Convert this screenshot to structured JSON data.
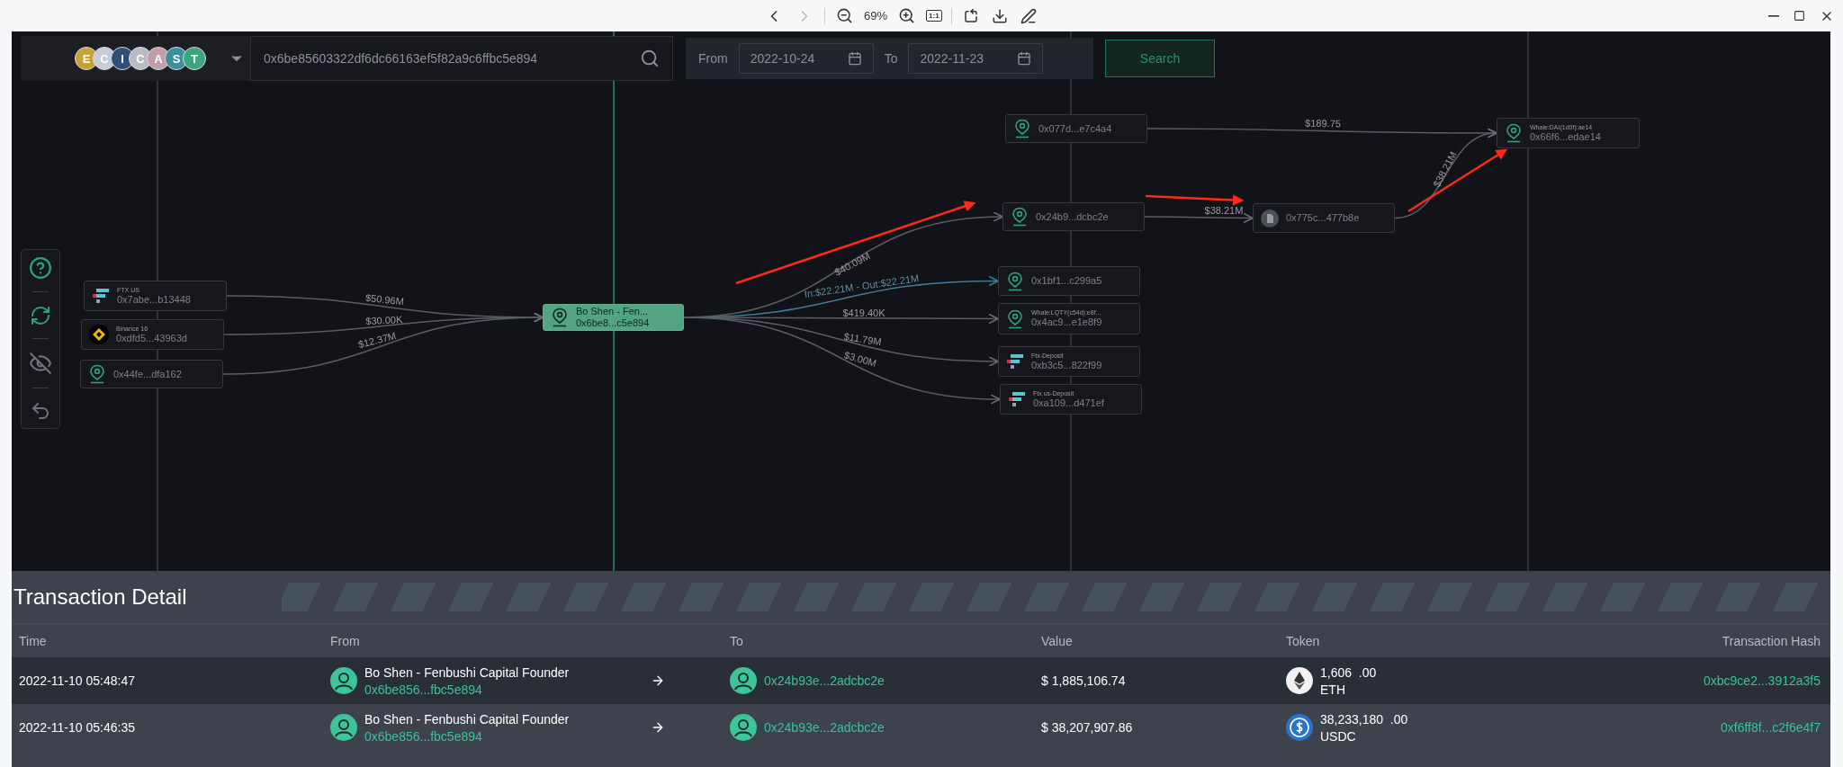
{
  "viewer_toolbar": {
    "forward_enabled": false,
    "zoom": "69%",
    "actual_size": "1:1"
  },
  "header": {
    "logo": [
      {
        "letter": "E",
        "color": "#c9a13a"
      },
      {
        "letter": "C",
        "color": "#c7ccd6"
      },
      {
        "letter": "I",
        "color": "#2f4f7a"
      },
      {
        "letter": "C",
        "color": "#b9bcc4"
      },
      {
        "letter": "A",
        "color": "#c59aa9"
      },
      {
        "letter": "S",
        "color": "#3a8f9a"
      },
      {
        "letter": "T",
        "color": "#3aa57f"
      }
    ],
    "search": {
      "value": "0x6be85603322df6dc66163ef5f82a9c6ffbc5e894"
    },
    "from_label": "From",
    "from_date": "2022-10-24",
    "to_label": "To",
    "to_date": "2022-11-23",
    "search_button": "Search"
  },
  "graph": {
    "nodes": [
      {
        "kind": "ftx",
        "label": "FTX US",
        "address": "0x7abe...b13448",
        "selected": false
      },
      {
        "kind": "binance",
        "label": "Binance 16",
        "address": "0xdfd5...43963d",
        "selected": false
      },
      {
        "kind": "wallet",
        "address": "0x44fe...dfa162",
        "selected": false
      },
      {
        "kind": "wallet",
        "label": "Bo Shen - Fen...",
        "address": "0x6be8...c5e894",
        "selected": true
      },
      {
        "kind": "wallet",
        "address": "0x077d...e7c4a4",
        "selected": false
      },
      {
        "kind": "wallet",
        "address": "0x24b9...dcbc2e",
        "selected": false
      },
      {
        "kind": "wallet",
        "address": "0x1bf1...c299a5",
        "selected": false
      },
      {
        "kind": "wallet",
        "label": "Whale:LQTY(c54d):e8f...",
        "address": "0x4ac9...e1e8f9",
        "selected": false
      },
      {
        "kind": "ftx",
        "label": "Ftx-Deposit",
        "address": "0xb3c5...822f99",
        "selected": false
      },
      {
        "kind": "ftx",
        "label": "Ftx us-Deposit",
        "address": "0xa109...d471ef",
        "selected": false
      },
      {
        "kind": "contract",
        "address": "0x775c...477b8e",
        "selected": false
      },
      {
        "kind": "wallet",
        "label": "Whale:DAI(1d0f):ae14",
        "address": "0x66f6...edae14",
        "selected": false
      }
    ],
    "edges": [
      {
        "label": "$50.96M",
        "kind": "plain"
      },
      {
        "label": "$30.00K",
        "kind": "plain"
      },
      {
        "label": "$12.37M",
        "kind": "plain"
      },
      {
        "label": "$40.09M",
        "kind": "plain"
      },
      {
        "label": "In:$22.21M - Out:$22.21M",
        "kind": "both"
      },
      {
        "label": "$419.40K",
        "kind": "plain"
      },
      {
        "label": "$11.79M",
        "kind": "plain"
      },
      {
        "label": "$3.00M",
        "kind": "plain"
      },
      {
        "label": "$189.75",
        "kind": "plain"
      },
      {
        "label": "$38.21M",
        "kind": "plain"
      },
      {
        "label": "$38.21M",
        "kind": "plain"
      }
    ]
  },
  "transaction_detail": {
    "title": "Transaction Detail",
    "columns": [
      "Time",
      "From",
      "To",
      "Value",
      "Token",
      "Transaction Hash"
    ],
    "rows": [
      {
        "time": "2022-11-10 05:48:47",
        "from_name": "Bo Shen - Fenbushi Capital Founder",
        "from_address": "0x6be856...fbc5e894",
        "to_address": "0x24b93e...2adcbc2e",
        "value": "$ 1,885,106.74",
        "kind": "eth",
        "amount": "1,606",
        "fraction": ".00",
        "symbol": "ETH",
        "hash": "0xbc9ce2...3912a3f5",
        "selected": true
      },
      {
        "time": "2022-11-10 05:46:35",
        "from_name": "Bo Shen - Fenbushi Capital Founder",
        "from_address": "0x6be856...fbc5e894",
        "to_address": "0x24b93e...2adcbc2e",
        "value": "$ 38,207,907.86",
        "kind": "usdc",
        "amount": "38,233,180",
        "fraction": ".00",
        "symbol": "USDC",
        "hash": "0xf6ff8f...c2f6e4f7",
        "selected": false
      }
    ]
  }
}
